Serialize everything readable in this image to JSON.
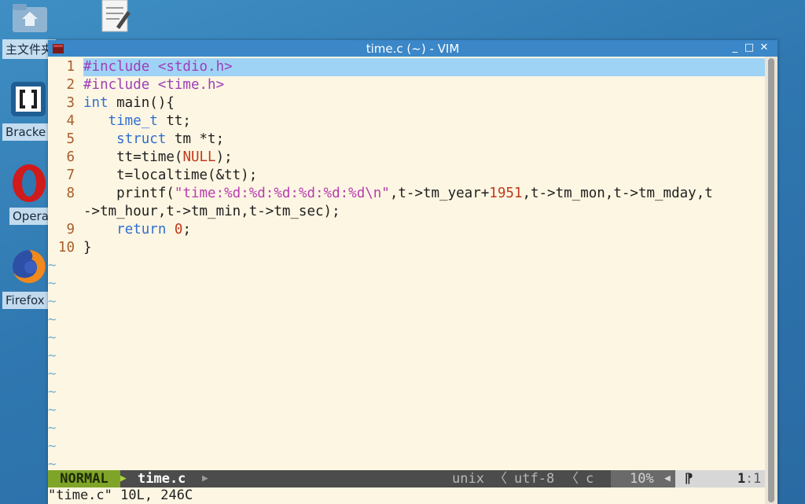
{
  "desktop": {
    "icons": [
      {
        "label": "主文件夹",
        "icon": "home-folder-icon"
      },
      {
        "label": "",
        "icon": "text-editor-icon"
      },
      {
        "label": "Bracke",
        "icon": "brackets-icon"
      },
      {
        "label": "Opera",
        "icon": "opera-icon"
      },
      {
        "label": "Firefox",
        "icon": "firefox-icon"
      }
    ]
  },
  "window": {
    "title": "time.c (~) - VIM",
    "buttons": {
      "minimize": "_",
      "maximize": "□",
      "close": "✕"
    }
  },
  "editor": {
    "lines": [
      {
        "num": "1",
        "segments": [
          {
            "t": "#include <stdio.h>",
            "c": "pre"
          }
        ]
      },
      {
        "num": "2",
        "segments": [
          {
            "t": "#include <time.h>",
            "c": "pre"
          }
        ]
      },
      {
        "num": "3",
        "segments": [
          {
            "t": "int",
            "c": "kw"
          },
          {
            "t": " main(){",
            "c": ""
          }
        ]
      },
      {
        "num": "4",
        "segments": [
          {
            "t": "   ",
            "c": ""
          },
          {
            "t": "time_t",
            "c": "kw"
          },
          {
            "t": " tt;",
            "c": ""
          }
        ]
      },
      {
        "num": "5",
        "segments": [
          {
            "t": "    ",
            "c": ""
          },
          {
            "t": "struct",
            "c": "kw"
          },
          {
            "t": " tm *t;",
            "c": ""
          }
        ]
      },
      {
        "num": "6",
        "segments": [
          {
            "t": "    tt=time(",
            "c": ""
          },
          {
            "t": "NULL",
            "c": "num"
          },
          {
            "t": ");",
            "c": ""
          }
        ]
      },
      {
        "num": "7",
        "segments": [
          {
            "t": "    t=localtime(&tt);",
            "c": ""
          }
        ]
      },
      {
        "num": "8",
        "segments": [
          {
            "t": "    printf(",
            "c": ""
          },
          {
            "t": "\"time:%d:%d:%d:%d:%d:%d\\n\"",
            "c": "str"
          },
          {
            "t": ",t->tm_year+",
            "c": ""
          },
          {
            "t": "1951",
            "c": "num"
          },
          {
            "t": ",t->tm_mon,t->tm_mday,t",
            "c": ""
          }
        ]
      },
      {
        "num": "",
        "segments": [
          {
            "t": "->tm_hour,t->tm_min,t->tm_sec);",
            "c": ""
          }
        ]
      },
      {
        "num": "9",
        "segments": [
          {
            "t": "    ",
            "c": ""
          },
          {
            "t": "return",
            "c": "kw"
          },
          {
            "t": " ",
            "c": ""
          },
          {
            "t": "0",
            "c": "num"
          },
          {
            "t": ";",
            "c": ""
          }
        ]
      },
      {
        "num": "10",
        "segments": [
          {
            "t": "}",
            "c": ""
          }
        ]
      }
    ],
    "tilde_char": "~",
    "tilde_count": 12
  },
  "statusbar": {
    "mode": "NORMAL",
    "filename": "time.c",
    "fileformat": "unix",
    "encoding": "utf-8",
    "filetype": "c",
    "percent": "10%",
    "position_line": "1",
    "position_col": "1"
  },
  "cmdline": {
    "message": "\"time.c\" 10L, 246C"
  },
  "colors": {
    "background": "#fdf6e3",
    "titlebar": "#3b87c8",
    "mode_bg": "#7fa528",
    "cursorline": "#9fd3f6"
  }
}
